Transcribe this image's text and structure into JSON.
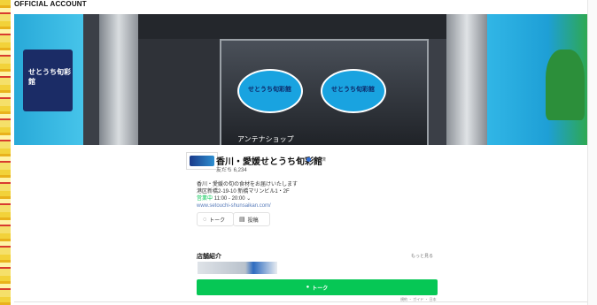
{
  "header": {
    "account_label": "OFFICIAL ACCOUNT"
  },
  "hero": {
    "sign_text": "せとうち旬彩館",
    "disc_text": "せとうち旬彩館",
    "antenna_text": "アンテナショップ"
  },
  "profile": {
    "name": "香川・愛媛せとうち旬彩館",
    "badge": "認証済",
    "friends": "友だち 6,234",
    "description": [
      "香川・愛媛の旬の食材をお届けいたします",
      "港区新橋2-19-10 新橋マリンビル1・2F"
    ],
    "status": "営業中",
    "hours": "11:00 - 20:00",
    "url": "www.setouchi-shunsaikan.com/"
  },
  "actions": {
    "talk": "トーク",
    "post": "投稿"
  },
  "section": {
    "title": "店舗紹介",
    "more": "もっと見る"
  },
  "main_button": {
    "label": "トーク"
  },
  "footer": {
    "links": "規約 ・ ガイド ・ 日本"
  },
  "colors": {
    "line_green": "#06c755"
  },
  "icons": {
    "talk": "chat-bubble-icon",
    "post": "notes-icon",
    "badge": "verified-badge-icon"
  }
}
